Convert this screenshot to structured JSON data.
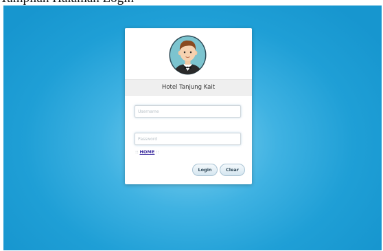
{
  "caption": "Tampilan Halaman Login",
  "header": {
    "title": "Hotel Tanjung Kait",
    "avatar_icon": "man-avatar-icon"
  },
  "form": {
    "username_placeholder": "Username",
    "password_placeholder": "Password",
    "home_prefix": "::",
    "home_link": "HOME",
    "home_suffix": "::",
    "login_label": "Login",
    "clear_label": "Clear"
  },
  "colors": {
    "background": "#1f9fd6",
    "button_border": "#a9c3d3",
    "link": "#3b2b9e"
  }
}
